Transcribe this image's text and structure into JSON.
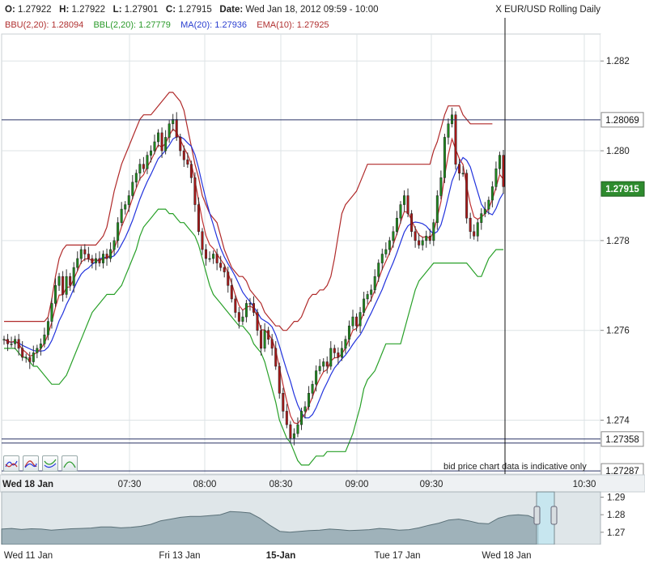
{
  "header": {
    "ohlc": [
      {
        "label": "O:",
        "value": "1.27922"
      },
      {
        "label": "H:",
        "value": "1.27922"
      },
      {
        "label": "L:",
        "value": "1.27901"
      },
      {
        "label": "C:",
        "value": "1.27915"
      },
      {
        "label": "Date:",
        "value": "Wed Jan 18, 2012 09:59 - 10:00"
      }
    ],
    "instrument": "X EUR/USD Rolling Daily",
    "indicators": [
      {
        "label": "BBU(2,20): 1.28094",
        "color": "#b03030"
      },
      {
        "label": "BBL(2,20): 1.27779",
        "color": "#2a9a2a"
      },
      {
        "label": "MA(20): 1.27936",
        "color": "#2a3fd0"
      },
      {
        "label": "EMA(10): 1.27925",
        "color": "#b03030"
      }
    ]
  },
  "toolbar": {
    "icons": [
      "bollinger-icon",
      "moving-average-icon",
      "envelope-icon",
      "curve-icon"
    ]
  },
  "disclaimer": "bid price chart data is indicative only",
  "colors": {
    "bollinger_upper": "#b02a2a",
    "bollinger_lower": "#28a028",
    "moving_average": "#2233dd",
    "ema": "#c03030",
    "candle_up": "#1f8a1f",
    "candle_down": "#a81818",
    "navigator_fill": "#9fb2ba",
    "last_price_badge": "#2e8b2e",
    "marker_badge": "#1a2a5a"
  },
  "chart_data": [
    {
      "type": "candlestick",
      "y_axis_position": "right",
      "ylim": [
        1.2728,
        1.2826
      ],
      "y_ticks": [
        "1.274",
        "1.276",
        "1.278",
        "1.280",
        "1.282"
      ],
      "x_start_label": "Wed 18 Jan",
      "x_ticks": [
        "07:30",
        "08:00",
        "08:30",
        "09:00",
        "09:30",
        "10:30"
      ],
      "crosshair_time": "18 Jan 09:59",
      "last_price": "1.27915",
      "horizontal_lines": [
        "1.28069",
        "1.27358",
        "1.27287"
      ],
      "indicator_legend": [
        "BBU(2,20)",
        "BBL(2,20)",
        "MA(20)",
        "EMA(10)"
      ],
      "close": [
        1.2758,
        1.2757,
        1.2757,
        1.2758,
        1.2756,
        1.2754,
        1.2754,
        1.2753,
        1.2755,
        1.2756,
        1.2757,
        1.2759,
        1.2762,
        1.2766,
        1.277,
        1.2772,
        1.2768,
        1.2772,
        1.277,
        1.2774,
        1.2776,
        1.2778,
        1.2777,
        1.2776,
        1.2775,
        1.2776,
        1.2775,
        1.2777,
        1.2776,
        1.2778,
        1.278,
        1.2784,
        1.2787,
        1.2788,
        1.279,
        1.2793,
        1.2795,
        1.2797,
        1.2796,
        1.2799,
        1.28,
        1.2802,
        1.2804,
        1.28,
        1.2803,
        1.2806,
        1.2807,
        1.2803,
        1.28,
        1.2798,
        1.2797,
        1.2794,
        1.2788,
        1.2782,
        1.2778,
        1.2776,
        1.2776,
        1.2777,
        1.2775,
        1.2774,
        1.2773,
        1.277,
        1.2767,
        1.2764,
        1.2762,
        1.2763,
        1.2766,
        1.2766,
        1.2764,
        1.276,
        1.2756,
        1.276,
        1.2758,
        1.2756,
        1.2752,
        1.2746,
        1.2742,
        1.2739,
        1.2736,
        1.2737,
        1.2739,
        1.2742,
        1.2743,
        1.2746,
        1.2748,
        1.2751,
        1.2752,
        1.2753,
        1.2752,
        1.2756,
        1.2755,
        1.2754,
        1.2756,
        1.2758,
        1.2761,
        1.2763,
        1.2761,
        1.2764,
        1.2767,
        1.2768,
        1.2769,
        1.2772,
        1.2775,
        1.2777,
        1.2778,
        1.278,
        1.2782,
        1.2785,
        1.2788,
        1.279,
        1.2786,
        1.2782,
        1.278,
        1.2779,
        1.278,
        1.2781,
        1.278,
        1.2784,
        1.279,
        1.2794,
        1.2803,
        1.2806,
        1.2808,
        1.2797,
        1.2795,
        1.2795,
        1.2785,
        1.2782,
        1.2781,
        1.2784,
        1.2786,
        1.2787,
        1.2789,
        1.2792,
        1.2796,
        1.2799,
        1.2792
      ],
      "upper_band": [
        1.2762,
        1.2762,
        1.2762,
        1.2762,
        1.2762,
        1.2762,
        1.2762,
        1.2762,
        1.2762,
        1.2762,
        1.2762,
        1.2762,
        1.2763,
        1.2767,
        1.2772,
        1.2776,
        1.2778,
        1.2779,
        1.2779,
        1.2779,
        1.2779,
        1.2779,
        1.2779,
        1.2779,
        1.2779,
        1.2779,
        1.278,
        1.2781,
        1.2783,
        1.2787,
        1.2791,
        1.2794,
        1.2797,
        1.2799,
        1.2801,
        1.2803,
        1.2805,
        1.2807,
        1.2808,
        1.2808,
        1.2808,
        1.2809,
        1.281,
        1.2811,
        1.2812,
        1.2813,
        1.2813,
        1.2812,
        1.2811,
        1.2809,
        1.2805,
        1.2801,
        1.2797,
        1.2794,
        1.279,
        1.2788,
        1.2786,
        1.2785,
        1.2784,
        1.2781,
        1.2778,
        1.2776,
        1.2774,
        1.2773,
        1.2772,
        1.2772,
        1.2771,
        1.2769,
        1.2768,
        1.2767,
        1.2766,
        1.2764,
        1.2763,
        1.2762,
        1.2761,
        1.2761,
        1.276,
        1.276,
        1.2761,
        1.2762,
        1.2762,
        1.2763,
        1.2765,
        1.2767,
        1.2768,
        1.2768,
        1.2769,
        1.2769,
        1.277,
        1.2772,
        1.2776,
        1.2781,
        1.2786,
        1.2788,
        1.2789,
        1.279,
        1.2791,
        1.2793,
        1.2795,
        1.2797,
        1.2797,
        1.2797,
        1.2797,
        1.2797,
        1.2797,
        1.2797,
        1.2797,
        1.2797,
        1.2797,
        1.2797,
        1.2797,
        1.2797,
        1.2797,
        1.2797,
        1.2797,
        1.2797,
        1.2797,
        1.28,
        1.2802,
        1.2805,
        1.2808,
        1.281,
        1.281,
        1.281,
        1.281,
        1.2808,
        1.2807,
        1.2806,
        1.2806,
        1.2806,
        1.2806,
        1.2806,
        1.2806,
        1.2806
      ],
      "lower_band": [
        1.2756,
        1.2756,
        1.2756,
        1.2756,
        1.2755,
        1.2754,
        1.2754,
        1.2753,
        1.2752,
        1.2752,
        1.2751,
        1.275,
        1.2749,
        1.2748,
        1.2748,
        1.2748,
        1.2749,
        1.275,
        1.2752,
        1.2754,
        1.2756,
        1.2758,
        1.276,
        1.2762,
        1.2764,
        1.2765,
        1.2766,
        1.2767,
        1.2768,
        1.2768,
        1.2768,
        1.2769,
        1.277,
        1.2772,
        1.2774,
        1.2776,
        1.2778,
        1.2781,
        1.2783,
        1.2784,
        1.2785,
        1.2786,
        1.2787,
        1.2787,
        1.2787,
        1.2786,
        1.2786,
        1.2785,
        1.2784,
        1.2784,
        1.2783,
        1.2782,
        1.2781,
        1.2779,
        1.2776,
        1.2773,
        1.277,
        1.2768,
        1.2767,
        1.2766,
        1.2765,
        1.2764,
        1.2763,
        1.2762,
        1.2761,
        1.2761,
        1.276,
        1.2759,
        1.2757,
        1.2756,
        1.2755,
        1.2753,
        1.275,
        1.2747,
        1.2744,
        1.274,
        1.2738,
        1.2736,
        1.2735,
        1.2733,
        1.2731,
        1.273,
        1.273,
        1.273,
        1.2731,
        1.2732,
        1.2732,
        1.2732,
        1.2733,
        1.2733,
        1.2733,
        1.2733,
        1.2733,
        1.2733,
        1.2735,
        1.2737,
        1.274,
        1.2743,
        1.2747,
        1.2749,
        1.275,
        1.2751,
        1.2753,
        1.2755,
        1.2757,
        1.2757,
        1.2757,
        1.2757,
        1.2757,
        1.276,
        1.2763,
        1.2766,
        1.2769,
        1.2771,
        1.2772,
        1.2773,
        1.2774,
        1.2775,
        1.2775,
        1.2775,
        1.2775,
        1.2775,
        1.2775,
        1.2775,
        1.2775,
        1.2775,
        1.2775,
        1.2774,
        1.2773,
        1.2772,
        1.2772,
        1.2774,
        1.2776,
        1.2777,
        1.2778,
        1.2778,
        1.2778
      ]
    },
    {
      "type": "area",
      "role": "navigator",
      "x_ticks": [
        "Wed 11 Jan",
        "Fri 13 Jan",
        "15-Jan",
        "Tue 17 Jan",
        "Wed 18 Jan"
      ],
      "y_ticks": [
        "1.29",
        "1.28",
        "1.27"
      ],
      "ylim": [
        1.263,
        1.293
      ],
      "values": [
        1.2718,
        1.2722,
        1.2716,
        1.272,
        1.2718,
        1.2712,
        1.2716,
        1.272,
        1.2722,
        1.2724,
        1.273,
        1.273,
        1.2725,
        1.2728,
        1.2734,
        1.2745,
        1.2765,
        1.2775,
        1.2785,
        1.279,
        1.279,
        1.2795,
        1.28,
        1.2818,
        1.2815,
        1.281,
        1.278,
        1.274,
        1.2705,
        1.27,
        1.2705,
        1.271,
        1.2712,
        1.2718,
        1.2715,
        1.271,
        1.2712,
        1.2715,
        1.2722,
        1.2718,
        1.2712,
        1.2715,
        1.2725,
        1.274,
        1.2752,
        1.277,
        1.2775,
        1.2765,
        1.2752,
        1.2748,
        1.278,
        1.2795,
        1.28,
        1.2795,
        1.277
      ]
    }
  ]
}
